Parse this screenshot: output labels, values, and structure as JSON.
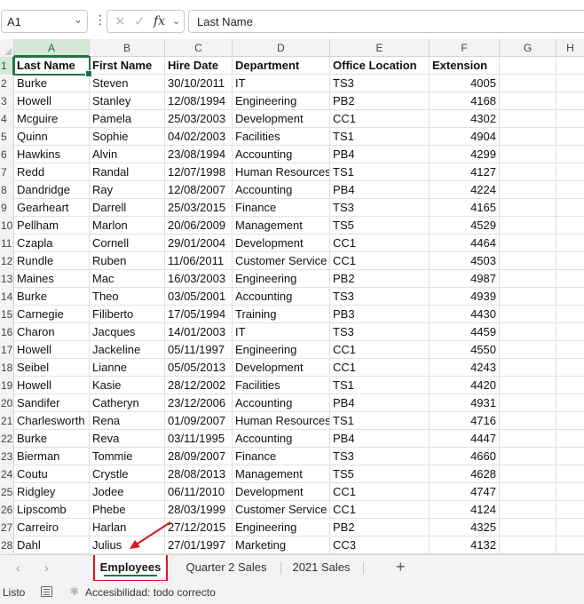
{
  "formula_bar": {
    "name_box": "A1",
    "formula_value": "Last Name",
    "fx_label": "fx"
  },
  "columns": [
    "A",
    "B",
    "C",
    "D",
    "E",
    "F",
    "G",
    "H"
  ],
  "row_numbers": [
    "1",
    "2",
    "3",
    "4",
    "5",
    "6",
    "7",
    "8",
    "9",
    "10",
    "11",
    "12",
    "13",
    "14",
    "15",
    "16",
    "17",
    "18",
    "19",
    "20",
    "21",
    "22",
    "23",
    "24",
    "25",
    "26",
    "27",
    "28"
  ],
  "headers": {
    "last_name": "Last Name",
    "first_name": "First Name",
    "hire_date": "Hire Date",
    "department": "Department",
    "office_location": "Office Location",
    "extension": "Extension"
  },
  "rows": [
    [
      "Burke",
      "Steven",
      "30/10/2011",
      "IT",
      "TS3",
      "4005"
    ],
    [
      "Howell",
      "Stanley",
      "12/08/1994",
      "Engineering",
      "PB2",
      "4168"
    ],
    [
      "Mcguire",
      "Pamela",
      "25/03/2003",
      "Development",
      "CC1",
      "4302"
    ],
    [
      "Quinn",
      "Sophie",
      "04/02/2003",
      "Facilities",
      "TS1",
      "4904"
    ],
    [
      "Hawkins",
      "Alvin",
      "23/08/1994",
      "Accounting",
      "PB4",
      "4299"
    ],
    [
      "Redd",
      "Randal",
      "12/07/1998",
      "Human Resources",
      "TS1",
      "4127"
    ],
    [
      "Dandridge",
      "Ray",
      "12/08/2007",
      "Accounting",
      "PB4",
      "4224"
    ],
    [
      "Gearheart",
      "Darrell",
      "25/03/2015",
      "Finance",
      "TS3",
      "4165"
    ],
    [
      "Pellham",
      "Marlon",
      "20/06/2009",
      "Management",
      "TS5",
      "4529"
    ],
    [
      "Czapla",
      "Cornell",
      "29/01/2004",
      "Development",
      "CC1",
      "4464"
    ],
    [
      "Rundle",
      "Ruben",
      "11/06/2011",
      "Customer Service",
      "CC1",
      "4503"
    ],
    [
      "Maines",
      "Mac",
      "16/03/2003",
      "Engineering",
      "PB2",
      "4987"
    ],
    [
      "Burke",
      "Theo",
      "03/05/2001",
      "Accounting",
      "TS3",
      "4939"
    ],
    [
      "Carnegie",
      "Filiberto",
      "17/05/1994",
      "Training",
      "PB3",
      "4430"
    ],
    [
      "Charon",
      "Jacques",
      "14/01/2003",
      "IT",
      "TS3",
      "4459"
    ],
    [
      "Howell",
      "Jackeline",
      "05/11/1997",
      "Engineering",
      "CC1",
      "4550"
    ],
    [
      "Seibel",
      "Lianne",
      "05/05/2013",
      "Development",
      "CC1",
      "4243"
    ],
    [
      "Howell",
      "Kasie",
      "28/12/2002",
      "Facilities",
      "TS1",
      "4420"
    ],
    [
      "Sandifer",
      "Catheryn",
      "23/12/2006",
      "Accounting",
      "PB4",
      "4931"
    ],
    [
      "Charlesworth",
      "Rena",
      "01/09/2007",
      "Human Resources",
      "TS1",
      "4716"
    ],
    [
      "Burke",
      "Reva",
      "03/11/1995",
      "Accounting",
      "PB4",
      "4447"
    ],
    [
      "Bierman",
      "Tommie",
      "28/09/2007",
      "Finance",
      "TS3",
      "4660"
    ],
    [
      "Coutu",
      "Crystle",
      "28/08/2013",
      "Management",
      "TS5",
      "4628"
    ],
    [
      "Ridgley",
      "Jodee",
      "06/11/2010",
      "Development",
      "CC1",
      "4747"
    ],
    [
      "Lipscomb",
      "Phebe",
      "28/03/1999",
      "Customer Service",
      "CC1",
      "4124"
    ],
    [
      "Carreiro",
      "Harlan",
      "27/12/2015",
      "Engineering",
      "PB2",
      "4325"
    ],
    [
      "Dahl",
      "Julius",
      "27/01/1997",
      "Marketing",
      "CC3",
      "4132"
    ]
  ],
  "sheet_tabs": {
    "active": "Employees",
    "tab2": "Quarter 2 Sales",
    "tab3": "2021 Sales",
    "add_symbol": "+"
  },
  "status_bar": {
    "ready": "Listo",
    "accessibility": "Accesibilidad: todo correcto"
  },
  "colors": {
    "accent_green": "#217346",
    "annotation_red": "#e0131d"
  }
}
